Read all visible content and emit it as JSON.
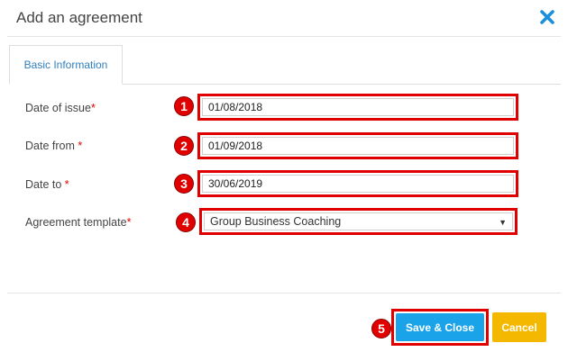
{
  "dialog": {
    "title": "Add an agreement",
    "close_icon": "close-icon"
  },
  "tabs": [
    {
      "label": "Basic Information",
      "active": true
    }
  ],
  "form": {
    "date_of_issue": {
      "label": "Date of issue",
      "required_mark": "*",
      "value": "01/08/2018",
      "marker": "1"
    },
    "date_from": {
      "label": "Date from ",
      "required_mark": "*",
      "value": "01/09/2018",
      "marker": "2"
    },
    "date_to": {
      "label": "Date to ",
      "required_mark": "*",
      "value": "30/06/2019",
      "marker": "3"
    },
    "agreement_template": {
      "label": "Agreement template",
      "required_mark": "*",
      "value": "Group Business Coaching",
      "marker": "4",
      "caret": "▼"
    }
  },
  "footer": {
    "save_label": "Save & Close",
    "save_marker": "5",
    "cancel_label": "Cancel"
  },
  "colors": {
    "accent_blue": "#1aa3e8",
    "cancel_yellow": "#f5b800",
    "annotation_red": "#e00000",
    "tab_text": "#2f7fbf"
  }
}
